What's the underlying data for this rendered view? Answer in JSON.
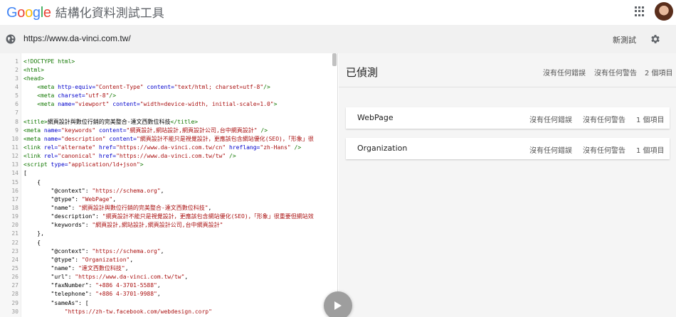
{
  "header": {
    "logo_letters": [
      {
        "char": "G",
        "color": "#4285F4"
      },
      {
        "char": "o",
        "color": "#EA4335"
      },
      {
        "char": "o",
        "color": "#FBBC05"
      },
      {
        "char": "g",
        "color": "#4285F4"
      },
      {
        "char": "l",
        "color": "#34A853"
      },
      {
        "char": "e",
        "color": "#EA4335"
      }
    ],
    "title": "結構化資料測試工具",
    "apps_icon": "apps-grid-icon",
    "avatar": "user-avatar"
  },
  "urlbar": {
    "url": "https://www.da-vinci.com.tw/",
    "new_test_label": "新測試",
    "settings_icon": "gear-icon",
    "globe_icon": "globe-icon"
  },
  "code": {
    "lines": [
      [
        [
          "t",
          "<!DOCTYPE html>"
        ]
      ],
      [
        [
          "t",
          "<html>"
        ]
      ],
      [
        [
          "t",
          "<head>"
        ]
      ],
      [
        [
          "p",
          "    "
        ],
        [
          "t",
          "<meta "
        ],
        [
          "a",
          "http-equiv="
        ],
        [
          "s",
          "\"Content-Type\" "
        ],
        [
          "a",
          "content="
        ],
        [
          "s",
          "\"text/html; charset=utf-8\""
        ],
        [
          "t",
          "/>"
        ]
      ],
      [
        [
          "p",
          "    "
        ],
        [
          "t",
          "<meta "
        ],
        [
          "a",
          "charset="
        ],
        [
          "s",
          "\"utf-8\""
        ],
        [
          "t",
          "/>"
        ]
      ],
      [
        [
          "p",
          "    "
        ],
        [
          "t",
          "<meta "
        ],
        [
          "a",
          "name="
        ],
        [
          "s",
          "\"viewport\" "
        ],
        [
          "a",
          "content="
        ],
        [
          "s",
          "\"width=device-width, initial-scale=1.0\""
        ],
        [
          "t",
          ">"
        ]
      ],
      [
        [
          "p",
          ""
        ]
      ],
      [
        [
          "t",
          "<title>"
        ],
        [
          "p",
          "網頁設計與數位行銷的完美整合-達文西數位科技"
        ],
        [
          "t",
          "</title>"
        ]
      ],
      [
        [
          "t",
          "<meta "
        ],
        [
          "a",
          "name="
        ],
        [
          "s",
          "\"keywords\" "
        ],
        [
          "a",
          "content="
        ],
        [
          "s",
          "\"網頁設計,網站設計,網頁設計公司,台中網頁設計\" "
        ],
        [
          "t",
          "/>"
        ]
      ],
      [
        [
          "t",
          "<meta "
        ],
        [
          "a",
          "name="
        ],
        [
          "s",
          "\"description\" "
        ],
        [
          "a",
          "content="
        ],
        [
          "s",
          "\"網頁設計不能只是視覺設計，更應該包含網站優化(SEO)，「形象」很"
        ]
      ],
      [
        [
          "t",
          "<link "
        ],
        [
          "a",
          "rel="
        ],
        [
          "s",
          "\"alternate\" "
        ],
        [
          "a",
          "href="
        ],
        [
          "s",
          "\"https://www.da-vinci.com.tw/cn\" "
        ],
        [
          "a",
          "hreflang="
        ],
        [
          "s",
          "\"zh-Hans\" "
        ],
        [
          "t",
          "/>"
        ]
      ],
      [
        [
          "t",
          "<link "
        ],
        [
          "a",
          "rel="
        ],
        [
          "s",
          "\"canonical\" "
        ],
        [
          "a",
          "href="
        ],
        [
          "s",
          "\"https://www.da-vinci.com.tw/tw\" "
        ],
        [
          "t",
          "/>"
        ]
      ],
      [
        [
          "t",
          "<script "
        ],
        [
          "a",
          "type="
        ],
        [
          "s",
          "\"application/ld+json\""
        ],
        [
          "t",
          ">"
        ]
      ],
      [
        [
          "p",
          "["
        ]
      ],
      [
        [
          "p",
          "    {"
        ]
      ],
      [
        [
          "p",
          "        "
        ],
        [
          "p",
          "\"@context\""
        ],
        [
          "p",
          ": "
        ],
        [
          "s",
          "\"https://schema.org\""
        ],
        [
          "p",
          ","
        ]
      ],
      [
        [
          "p",
          "        "
        ],
        [
          "p",
          "\"@type\""
        ],
        [
          "p",
          ": "
        ],
        [
          "s",
          "\"WebPage\""
        ],
        [
          "p",
          ","
        ]
      ],
      [
        [
          "p",
          "        "
        ],
        [
          "p",
          "\"name\""
        ],
        [
          "p",
          ": "
        ],
        [
          "s",
          "\"網頁設計與數位行銷的完美整合-達文西數位科技\""
        ],
        [
          "p",
          ","
        ]
      ],
      [
        [
          "p",
          "        "
        ],
        [
          "p",
          "\"description\""
        ],
        [
          "p",
          ": "
        ],
        [
          "s",
          "\"網頁設計不能只是視覺設計，更應該包含網站優化(SEO)，「形象」很重要但網站效"
        ]
      ],
      [
        [
          "p",
          "        "
        ],
        [
          "p",
          "\"keywords\""
        ],
        [
          "p",
          ": "
        ],
        [
          "s",
          "\"網頁設計,網站設計,網頁設計公司,台中網頁設計\""
        ]
      ],
      [
        [
          "p",
          "    },"
        ]
      ],
      [
        [
          "p",
          "    {"
        ]
      ],
      [
        [
          "p",
          "        "
        ],
        [
          "p",
          "\"@context\""
        ],
        [
          "p",
          ": "
        ],
        [
          "s",
          "\"https://schema.org\""
        ],
        [
          "p",
          ","
        ]
      ],
      [
        [
          "p",
          "        "
        ],
        [
          "p",
          "\"@type\""
        ],
        [
          "p",
          ": "
        ],
        [
          "s",
          "\"Organization\""
        ],
        [
          "p",
          ","
        ]
      ],
      [
        [
          "p",
          "        "
        ],
        [
          "p",
          "\"name\""
        ],
        [
          "p",
          ": "
        ],
        [
          "s",
          "\"達文西數位科技\""
        ],
        [
          "p",
          ","
        ]
      ],
      [
        [
          "p",
          "        "
        ],
        [
          "p",
          "\"url\""
        ],
        [
          "p",
          ": "
        ],
        [
          "s",
          "\"https://www.da-vinci.com.tw/tw\""
        ],
        [
          "p",
          ","
        ]
      ],
      [
        [
          "p",
          "        "
        ],
        [
          "p",
          "\"faxNumber\""
        ],
        [
          "p",
          ": "
        ],
        [
          "s",
          "\"+886 4-3701-5588\""
        ],
        [
          "p",
          ","
        ]
      ],
      [
        [
          "p",
          "        "
        ],
        [
          "p",
          "\"telephone\""
        ],
        [
          "p",
          ": "
        ],
        [
          "s",
          "\"+886 4-3701-9988\""
        ],
        [
          "p",
          ","
        ]
      ],
      [
        [
          "p",
          "        "
        ],
        [
          "p",
          "\"sameAs\""
        ],
        [
          "p",
          ": ["
        ]
      ],
      [
        [
          "p",
          "            "
        ],
        [
          "s",
          "\"https://zh-tw.facebook.com/webdesign.corp\""
        ]
      ],
      [
        [
          "p",
          "        ]"
        ]
      ]
    ]
  },
  "results": {
    "title": "已偵測",
    "errors": "沒有任何錯誤",
    "warnings": "沒有任何警告",
    "count": "2 個項目",
    "items": [
      {
        "name": "WebPage",
        "errors": "沒有任何錯誤",
        "warnings": "沒有任何警告",
        "count": "1 個項目"
      },
      {
        "name": "Organization",
        "errors": "沒有任何錯誤",
        "warnings": "沒有任何警告",
        "count": "1 個項目"
      }
    ]
  },
  "run_button_icon": "play-icon"
}
